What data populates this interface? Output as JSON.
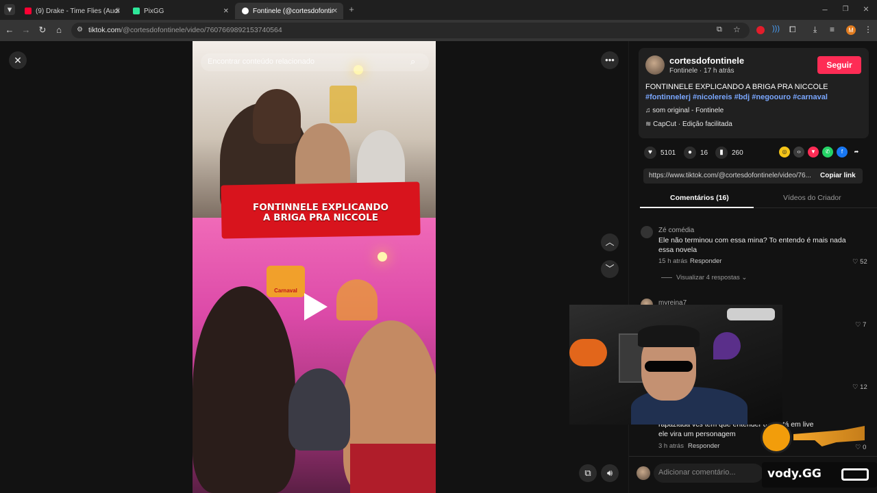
{
  "browser": {
    "tabs": [
      {
        "label": "(9) Drake - Time Flies (Audio) -",
        "color": "#ff0033"
      },
      {
        "label": "PixGG",
        "color": "#2ee89a"
      },
      {
        "label": "Fontinele (@cortesdofontinele)",
        "color": "#ffffff"
      }
    ],
    "url_domain": "tiktok.com",
    "url_path": "/@cortesdofontinele/video/7607669892153740564",
    "profile_initial": "M"
  },
  "video": {
    "search_placeholder": "Encontrar conteúdo relacionado",
    "banner_line1": "FONTINNELE EXPLICANDO",
    "banner_line2": "A BRIGA PRA NICCOLE",
    "overlay_sign": "Carnaval"
  },
  "post": {
    "username": "cortesdofontinele",
    "subline": "Fontinele · 17 h atrás",
    "follow_label": "Seguir",
    "caption": "FONTINNELE EXPLICANDO A BRIGA PRA NICCOLE",
    "hashtags": "#fontinnelerj #nicolereis #bdj #negoouro #carnaval",
    "sound": "som original - Fontinele",
    "capcut": "CapCut · Edição facilitada",
    "likes": "5101",
    "comments": "16",
    "saves": "260",
    "link": "https://www.tiktok.com/@cortesdofontinele/video/76...",
    "copy_link": "Copiar link"
  },
  "panel_tabs": {
    "comments": "Comentários (16)",
    "creator": "Vídeos do Criador"
  },
  "comments": [
    {
      "name": "Zé comédia",
      "text": "Ele não terminou com essa mina? To entendo é mais nada essa novela",
      "time": "15 h atrás",
      "reply": "Responder",
      "likes": "52",
      "replies": "Visualizar 4 respostas"
    },
    {
      "name": "myreina7",
      "likes": "7"
    },
    {
      "likes": "12"
    },
    {
      "text": "rapaziada vcs tem que entender q                a está em live ele vira um personagem",
      "time": "3 h atrás",
      "reply": "Responder",
      "likes": "0"
    }
  ],
  "add_comment_placeholder": "Adicionar comentário...",
  "watermark": "vody.GG"
}
